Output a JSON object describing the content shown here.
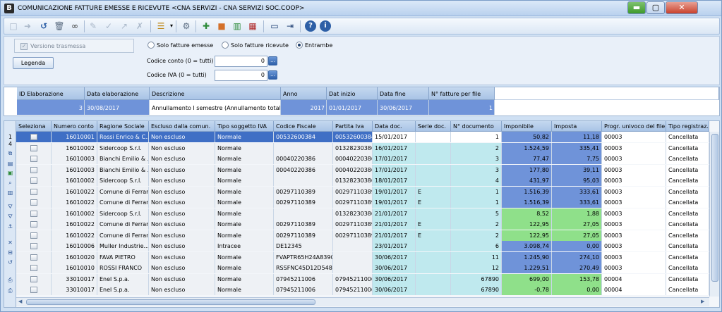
{
  "window": {
    "app_letter": "B",
    "title": "COMUNICAZIONE FATTURE EMESSE E RICEVUTE <CNA SERVIZI - CNA SERVIZI SOC.COOP>",
    "minimize": "▬",
    "maximize": "▢",
    "close": "✕"
  },
  "toolbar": {
    "icons": [
      "new-icon",
      "forward-icon",
      "undo-icon",
      "trash-icon",
      "binoculars-icon",
      "edit-icon",
      "edit-check-icon",
      "edit-arrow-icon",
      "edit-cancel-icon",
      "list-menu-icon",
      "gear-icon",
      "add-document-icon",
      "folder-icon",
      "books-icon",
      "grid-report-icon",
      "monitor-icon",
      "exit-door-icon",
      "help-icon",
      "info-icon"
    ]
  },
  "filters": {
    "versione_label": "Versione trasmessa",
    "legenda_label": "Legenda",
    "radio_emesse": "Solo fatture emesse",
    "radio_ricevute": "Solo fatture ricevute",
    "radio_entrambe": "Entrambe",
    "codice_conto_label": "Codice conto (0 = tutti)",
    "codice_conto_value": "0",
    "codice_iva_label": "Codice IVA (0 = tutti)",
    "codice_iva_value": "0",
    "lookup_btn": "..."
  },
  "elaborazione": {
    "headers": [
      "ID Elaborazione",
      "Data elaborazione",
      "Descrizione",
      "Anno",
      "Dat inizio",
      "Data fine",
      "N° fatture per file"
    ],
    "row": [
      "3",
      "30/08/2017",
      "Annullamento I semestre (Annullamento totale)",
      "2017",
      "01/01/2017",
      "30/06/2017",
      "1"
    ]
  },
  "grid": {
    "headers": [
      "Seleziona",
      "Numero conto",
      "Ragione Sociale",
      "Escluso dalla comun.",
      "Tipo soggetto IVA",
      "Codice Fiscale",
      "Partita Iva",
      "Data doc.",
      "Serie doc.",
      "N° documento",
      "Imponibile",
      "Imposta",
      "Progr. univoco del file",
      "Tipo registraz."
    ],
    "row_indicator": "1",
    "row_count_indicator": "4",
    "rows": [
      [
        "",
        "16010001",
        "Rossi Enrico & C...",
        "Non escluso",
        "Normale",
        "00532600384",
        "00532600384",
        "15/01/2017",
        "",
        "1",
        "50,82",
        "11,18",
        "00003",
        "Cancellata"
      ],
      [
        "",
        "16010002",
        "Sidercoop S.r.l.",
        "Non escluso",
        "Normale",
        "",
        "01328230386",
        "16/01/2017",
        "",
        "2",
        "1.524,59",
        "335,41",
        "00003",
        "Cancellata"
      ],
      [
        "",
        "16010003",
        "Bianchi Emilio & ...",
        "Non escluso",
        "Normale",
        "00040220386",
        "00040220386",
        "17/01/2017",
        "",
        "3",
        "77,47",
        "7,75",
        "00003",
        "Cancellata"
      ],
      [
        "",
        "16010003",
        "Bianchi Emilio & ...",
        "Non escluso",
        "Normale",
        "00040220386",
        "00040220386",
        "17/01/2017",
        "",
        "3",
        "177,80",
        "39,11",
        "00003",
        "Cancellata"
      ],
      [
        "",
        "16010002",
        "Sidercoop S.r.l.",
        "Non escluso",
        "Normale",
        "",
        "01328230386",
        "18/01/2017",
        "",
        "4",
        "431,97",
        "95,03",
        "00003",
        "Cancellata"
      ],
      [
        "",
        "16010022",
        "Comune di Ferrara",
        "Non escluso",
        "Normale",
        "00297110389",
        "00297110389",
        "19/01/2017",
        "E",
        "1",
        "1.516,39",
        "333,61",
        "00003",
        "Cancellata"
      ],
      [
        "",
        "16010022",
        "Comune di Ferrara",
        "Non escluso",
        "Normale",
        "00297110389",
        "00297110389",
        "19/01/2017",
        "E",
        "1",
        "1.516,39",
        "333,61",
        "00003",
        "Cancellata"
      ],
      [
        "",
        "16010002",
        "Sidercoop S.r.l.",
        "Non escluso",
        "Normale",
        "",
        "01328230386",
        "21/01/2017",
        "",
        "5",
        "8,52",
        "1,88",
        "00003",
        "Cancellata"
      ],
      [
        "",
        "16010022",
        "Comune di Ferrara",
        "Non escluso",
        "Normale",
        "00297110389",
        "00297110389",
        "21/01/2017",
        "E",
        "2",
        "122,95",
        "27,05",
        "00003",
        "Cancellata"
      ],
      [
        "",
        "16010022",
        "Comune di Ferrara",
        "Non escluso",
        "Normale",
        "00297110389",
        "00297110389",
        "21/01/2017",
        "E",
        "2",
        "122,95",
        "27,05",
        "00003",
        "Cancellata"
      ],
      [
        "",
        "16010006",
        "Muller Industrie...",
        "Non escluso",
        "Intracee",
        "DE12345",
        "",
        "23/01/2017",
        "",
        "6",
        "3.098,74",
        "0,00",
        "00003",
        "Cancellata"
      ],
      [
        "",
        "16010020",
        "FAVA PIETRO",
        "Non escluso",
        "Normale",
        "FVAPTR65H24A839Q",
        "",
        "30/06/2017",
        "",
        "11",
        "1.245,90",
        "274,10",
        "00003",
        "Cancellata"
      ],
      [
        "",
        "16010010",
        "ROSSI FRANCO",
        "Non escluso",
        "Normale",
        "RSSFNC45D12D548B",
        "",
        "30/06/2017",
        "",
        "12",
        "1.229,51",
        "270,49",
        "00003",
        "Cancellata"
      ],
      [
        "",
        "33010017",
        "Enel S.p.a.",
        "Non escluso",
        "Normale",
        "07945211006",
        "07945211006",
        "30/06/2017",
        "",
        "67890",
        "699,00",
        "153,78",
        "00004",
        "Cancellata"
      ],
      [
        "",
        "33010017",
        "Enel S.p.a.",
        "Non escluso",
        "Normale",
        "07945211006",
        "07945211006",
        "30/06/2017",
        "",
        "67890",
        "-0,78",
        "0,00",
        "00004",
        "Cancellata"
      ]
    ]
  },
  "colors": {
    "header_bg": "#b3cbe9",
    "selected_row": "#3f6fc5",
    "blue_cell": "#6f93d9",
    "green_cell": "#8fe08a",
    "date_cell": "#bfe9ee"
  }
}
